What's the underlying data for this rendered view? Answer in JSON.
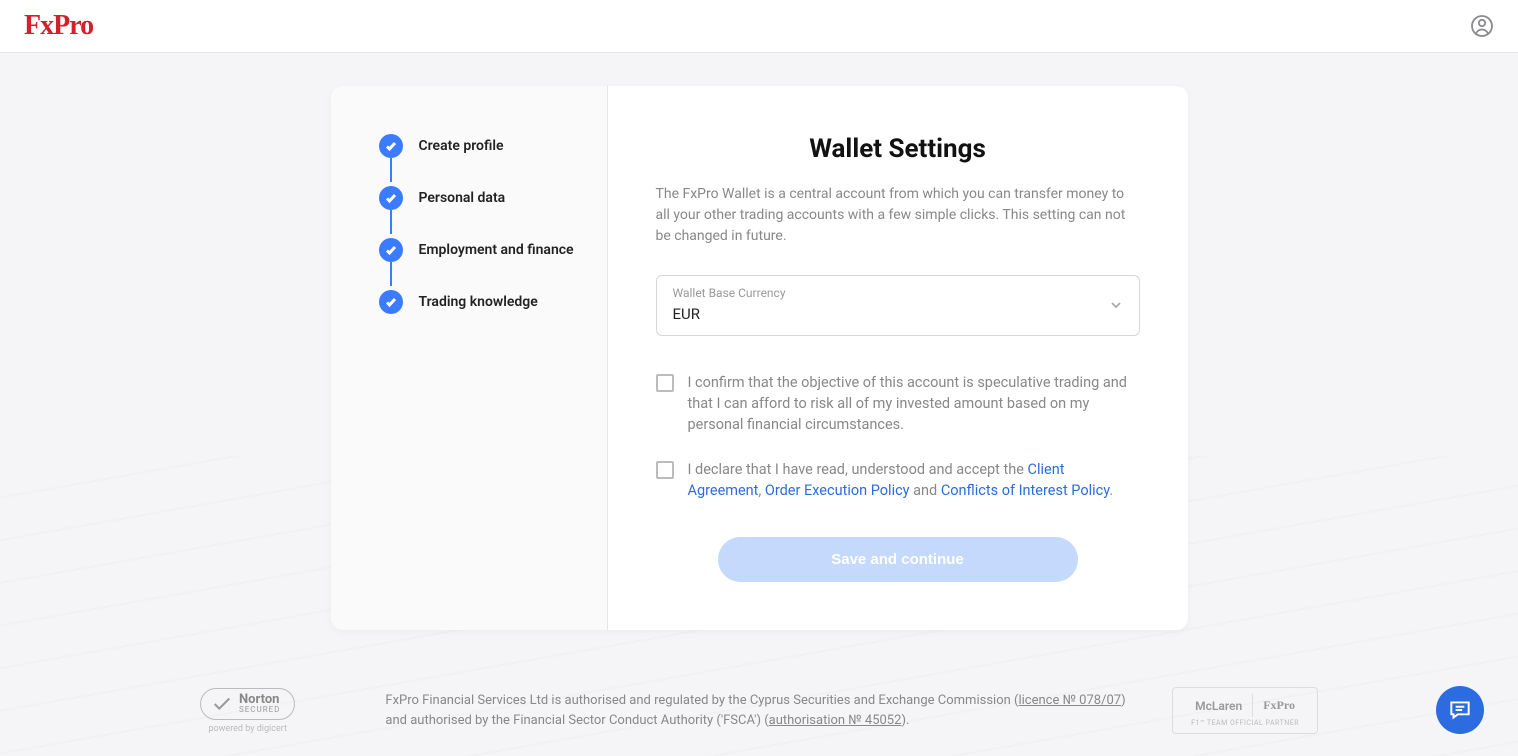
{
  "header": {
    "logo": "FxPro"
  },
  "sidebar": {
    "steps": [
      {
        "label": "Create profile"
      },
      {
        "label": "Personal data"
      },
      {
        "label": "Employment and finance"
      },
      {
        "label": "Trading knowledge"
      }
    ]
  },
  "main": {
    "title": "Wallet Settings",
    "description": "The FxPro Wallet is a central account from which you can transfer money to all your other trading accounts with a few simple clicks. This setting can not be changed in future.",
    "currency_label": "Wallet Base Currency",
    "currency_value": "EUR",
    "confirm1": "I confirm that the objective of this account is speculative trading and that I can afford to risk all of my invested amount based on my personal financial circumstances.",
    "confirm2_prefix": "I declare that I have read, understood and accept the ",
    "link_client_agreement": "Client Agreement",
    "sep1": ", ",
    "link_order_exec": "Order Execution Policy",
    "sep2": " and ",
    "link_conflicts": "Conflicts of Interest Policy",
    "period": ".",
    "submit": "Save and continue"
  },
  "footer": {
    "norton_main": "Norton",
    "norton_secured": "SECURED",
    "norton_powered": "powered by digicert",
    "text_p1": "FxPro Financial Services Ltd is authorised and regulated by the Cyprus Securities and Exchange Commission (",
    "link_licence": "licence № 078/07",
    "text_p2": ") and authorised by the Financial Sector Conduct Authority ('FSCA') (",
    "link_auth": "authorisation № 45052",
    "text_p3": ").",
    "partner_1": "McLaren",
    "partner_2": "FxPro",
    "partner_sub": "F1™ TEAM OFFICIAL PARTNER"
  }
}
